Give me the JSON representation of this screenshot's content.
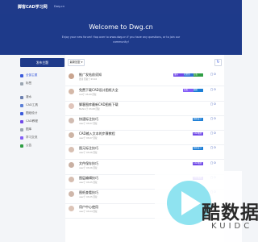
{
  "header": {
    "logo": "脚客CAD学习网",
    "domain": "Dwg.cn"
  },
  "hero": {
    "title": "Welcome to Dwg.cn",
    "subtitle": "Enjoy your new forum! Hop over to www.dwg.cn if you have any questions, or to join our community!"
  },
  "sidebar": {
    "new_button": "发布主题",
    "items": [
      {
        "label": "全部主题",
        "color": "#3b5bdb"
      },
      {
        "label": "标签",
        "color": "#9aa5b1"
      },
      {
        "label": "灌水",
        "color": "#6b7fb0"
      },
      {
        "label": "CAD工具",
        "color": "#5b7fd6"
      },
      {
        "label": "图纸设计",
        "color": "#3b5bdb"
      },
      {
        "label": "CAD教程",
        "color": "#7048e8"
      },
      {
        "label": "图库",
        "color": "#9aa5b1"
      },
      {
        "label": "学习交流",
        "color": "#845ef7"
      },
      {
        "label": "公告",
        "color": "#2f9e44"
      }
    ]
  },
  "toolbar": {
    "sort_label": "最新回复",
    "refresh_icon": "refresh-icon"
  },
  "discussions": [
    {
      "title": "推广发帖前须知",
      "meta": "置顶 回复于 03-10",
      "tags": [
        {
          "text": "灌水",
          "color": "#7048e8"
        },
        {
          "text": "已置顶",
          "color": "#2f6fd6"
        },
        {
          "text": "公告",
          "color": "#2f9e44"
        }
      ],
      "count": "0",
      "avatar": "#c9a48f"
    },
    {
      "title": "免费下载CAD设计图纸大全",
      "meta": "cad于 03-09 回复",
      "tags": [
        {
          "text": "标签",
          "color": "#845ef7"
        },
        {
          "text": "图纸",
          "color": "#1c7ed6"
        }
      ],
      "count": "0",
      "avatar": "#d4b8a8"
    },
    {
      "title": "脚客图库最新CAD图纸下载",
      "meta": "Mahiro于 03-08 回复",
      "tags": [],
      "count": "0",
      "avatar": "#e0c5bb"
    },
    {
      "title": "快速标注技巧",
      "meta": "user于 03-07 回复",
      "tags": [
        {
          "text": "图纸设计",
          "color": "#1c7ed6"
        }
      ],
      "count": "0",
      "avatar": "#d1bcb2"
    },
    {
      "title": "CAD输入文本的步骤教程",
      "meta": "user于 03-07 回复",
      "tags": [
        {
          "text": "CAD教程",
          "color": "#7048e8"
        }
      ],
      "count": "0",
      "avatar": "#cdb4a5"
    },
    {
      "title": "图元标注技巧",
      "meta": "user于 03-06 回复",
      "tags": [
        {
          "text": "图纸设计",
          "color": "#1c7ed6"
        }
      ],
      "count": "0",
      "avatar": "#d8c0b3"
    },
    {
      "title": "文件保存技巧",
      "meta": "user于 03-06 回复",
      "tags": [
        {
          "text": "CAD教程",
          "color": "#7048e8"
        }
      ],
      "count": "0",
      "avatar": "#c9b0a2"
    },
    {
      "title": "图层编辑技巧",
      "meta": "user于 03-05 回复",
      "tags": [
        {
          "text": "CAD教程",
          "color": "#7048e8"
        }
      ],
      "count": "0",
      "avatar": "#d6beb1"
    },
    {
      "title": "图纸查看技巧",
      "meta": "user于 03-05 回复",
      "tags": [
        {
          "text": "CAD教程",
          "color": "#7048e8"
        }
      ],
      "count": "0",
      "avatar": "#cfb7aa"
    },
    {
      "title": "用户中心使用",
      "meta": "user于 03-04 回复",
      "tags": [
        {
          "text": "CAD教程",
          "color": "#7048e8"
        }
      ],
      "count": "0",
      "avatar": "#dcc4b7"
    }
  ],
  "watermark": {
    "text": "酷数据",
    "sub": "KUIDC"
  }
}
